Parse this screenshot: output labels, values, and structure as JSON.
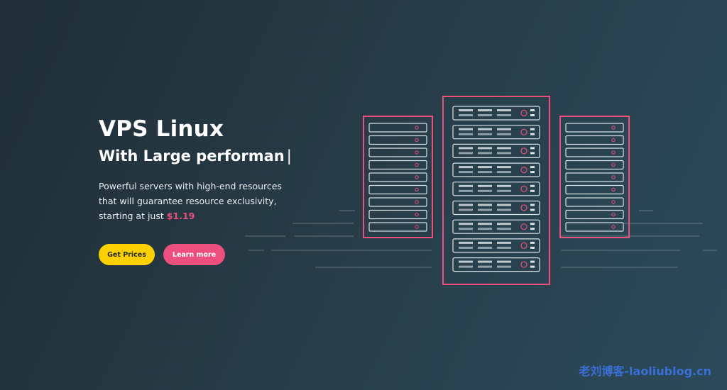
{
  "hero": {
    "title": "VPS Linux",
    "subtitle": "With Large performan",
    "cursor": "|",
    "description_lines": [
      "Powerful servers with high-end resources",
      "that will guarantee resource exclusivity,",
      "starting at just "
    ],
    "price": "$1.19"
  },
  "buttons": {
    "get_prices": "Get Prices",
    "learn_more": "Learn more"
  },
  "illustration": {
    "icon": "server-rack-icon",
    "rack_count": 3
  },
  "watermark": "老刘博客-laoliublog.cn",
  "colors": {
    "accent_pink": "#ec4f7d",
    "accent_yellow": "#fdd000",
    "rack_outline": "#d9e3e8"
  }
}
